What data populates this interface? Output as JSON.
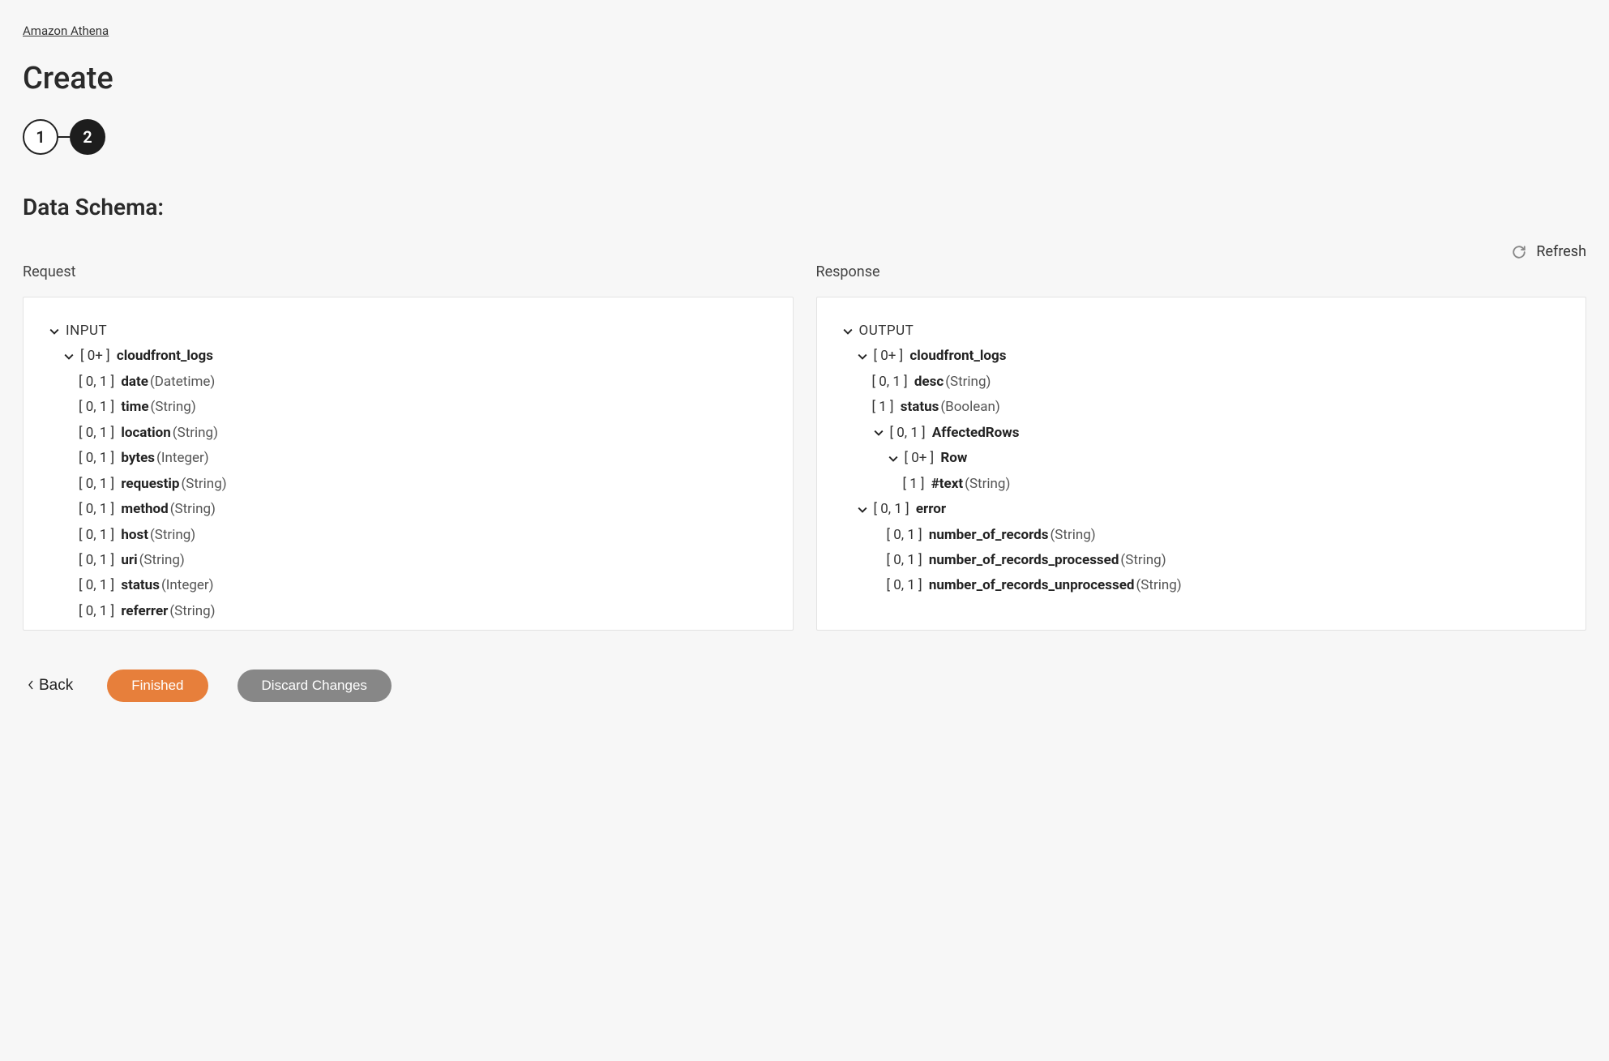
{
  "breadcrumb": "Amazon Athena",
  "page_title": "Create",
  "stepper": {
    "step1": "1",
    "step2": "2"
  },
  "section_title": "Data Schema:",
  "refresh_label": "Refresh",
  "request_label": "Request",
  "response_label": "Response",
  "request_root": "INPUT",
  "response_root": "OUTPUT",
  "request_tree": {
    "group_card": "[ 0+ ]",
    "group_name": "cloudfront_logs",
    "fields": [
      {
        "card": "[ 0, 1 ]",
        "name": "date",
        "type": "(Datetime)"
      },
      {
        "card": "[ 0, 1 ]",
        "name": "time",
        "type": "(String)"
      },
      {
        "card": "[ 0, 1 ]",
        "name": "location",
        "type": "(String)"
      },
      {
        "card": "[ 0, 1 ]",
        "name": "bytes",
        "type": "(Integer)"
      },
      {
        "card": "[ 0, 1 ]",
        "name": "requestip",
        "type": "(String)"
      },
      {
        "card": "[ 0, 1 ]",
        "name": "method",
        "type": "(String)"
      },
      {
        "card": "[ 0, 1 ]",
        "name": "host",
        "type": "(String)"
      },
      {
        "card": "[ 0, 1 ]",
        "name": "uri",
        "type": "(String)"
      },
      {
        "card": "[ 0, 1 ]",
        "name": "status",
        "type": "(Integer)"
      },
      {
        "card": "[ 0, 1 ]",
        "name": "referrer",
        "type": "(String)"
      }
    ]
  },
  "response_tree": {
    "group_card": "[ 0+ ]",
    "group_name": "cloudfront_logs",
    "direct": [
      {
        "card": "[ 0, 1 ]",
        "name": "desc",
        "type": "(String)"
      },
      {
        "card": "[ 1 ]",
        "name": "status",
        "type": "(Boolean)"
      }
    ],
    "affected": {
      "card": "[ 0, 1 ]",
      "name": "AffectedRows"
    },
    "row": {
      "card": "[ 0+ ]",
      "name": "Row"
    },
    "row_child": {
      "card": "[ 1 ]",
      "name": "#text",
      "type": "(String)"
    },
    "error": {
      "card": "[ 0, 1 ]",
      "name": "error"
    },
    "error_children": [
      {
        "card": "[ 0, 1 ]",
        "name": "number_of_records",
        "type": "(String)"
      },
      {
        "card": "[ 0, 1 ]",
        "name": "number_of_records_processed",
        "type": "(String)"
      },
      {
        "card": "[ 0, 1 ]",
        "name": "number_of_records_unprocessed",
        "type": "(String)"
      }
    ]
  },
  "footer": {
    "back": "Back",
    "finished": "Finished",
    "discard": "Discard Changes"
  }
}
